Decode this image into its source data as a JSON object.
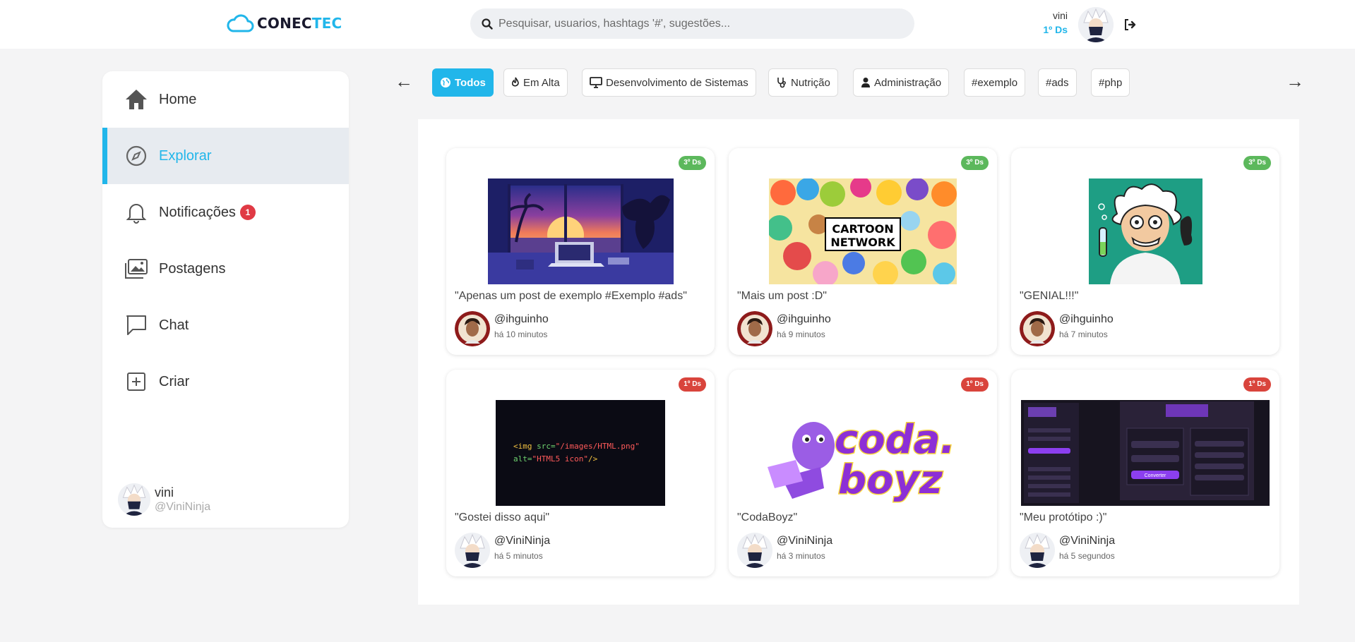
{
  "header": {
    "logo_part1": "CONEC",
    "logo_part2": "TEC",
    "search_placeholder": "Pesquisar, usuarios, hashtags '#', sugestões...",
    "user_name": "vini",
    "user_class": "1º Ds"
  },
  "sidebar": {
    "items": [
      {
        "label": "Home",
        "icon": "home-icon"
      },
      {
        "label": "Explorar",
        "icon": "compass-icon",
        "active": true
      },
      {
        "label": "Notificações",
        "icon": "bell-icon",
        "badge": "1"
      },
      {
        "label": "Postagens",
        "icon": "images-icon"
      },
      {
        "label": "Chat",
        "icon": "chat-icon"
      },
      {
        "label": "Criar",
        "icon": "plus-square-icon"
      }
    ],
    "user": {
      "name": "vini",
      "handle": "@ViniNinja"
    }
  },
  "filters": {
    "prev": "←",
    "next": "→",
    "chips": [
      {
        "label": "Todos",
        "icon": "globe-icon"
      },
      {
        "label": "Em Alta",
        "icon": "fire-icon"
      },
      {
        "label": "Desenvolvimento de Sistemas",
        "icon": "monitor-icon"
      },
      {
        "label": "Nutrição",
        "icon": "stethoscope-icon"
      },
      {
        "label": "Administração",
        "icon": "person-icon"
      },
      {
        "label": "#exemplo"
      },
      {
        "label": "#ads"
      },
      {
        "label": "#php"
      }
    ]
  },
  "posts": [
    {
      "tag": "3º Ds",
      "caption": "\"Apenas um post de exemplo #Exemplo #ads\"",
      "author": "@ihguinho",
      "time": "há 10 minutos",
      "image": "sunset-desk-illustration"
    },
    {
      "tag": "3º Ds",
      "caption": "\"Mais um post :D\"",
      "author": "@ihguinho",
      "time": "há 9 minutos",
      "image": "cartoon-network-collage",
      "image_text": [
        "CARTOON",
        "NETWORK"
      ]
    },
    {
      "tag": "3º Ds",
      "caption": "\"GENIAL!!!\"",
      "author": "@ihguinho",
      "time": "há 7 minutos",
      "image": "mad-scientist-cartoon"
    },
    {
      "tag": "1º Ds",
      "caption": "\"Gostei disso aqui\"",
      "author": "@ViniNinja",
      "time": "há 5 minutos",
      "image": "html-code-snippet",
      "code_line1_tag": "<img",
      "code_line1_attr": "src=",
      "code_line1_val": "\"/images/HTML.png\"",
      "code_line2_attr": "alt=",
      "code_line2_val": "\"HTML5 icon\"",
      "code_line2_end": "/>"
    },
    {
      "tag": "1º Ds",
      "caption": "\"CodaBoyz\"",
      "author": "@ViniNinja",
      "time": "há 3 minutos",
      "image": "codaboyz-logo",
      "logo_line1": "coda.",
      "logo_line2": "boyz"
    },
    {
      "tag": "1º Ds",
      "caption": "\"Meu protótipo :)\"",
      "author": "@ViniNinja",
      "time": "há 5 segundos",
      "image": "prototype-screenshot",
      "proto_button": "Converter"
    }
  ],
  "colors": {
    "accent": "#21b6ea",
    "green_tag": "#5cb85c",
    "red_tag": "#d9443c",
    "badge": "#e03a45"
  }
}
